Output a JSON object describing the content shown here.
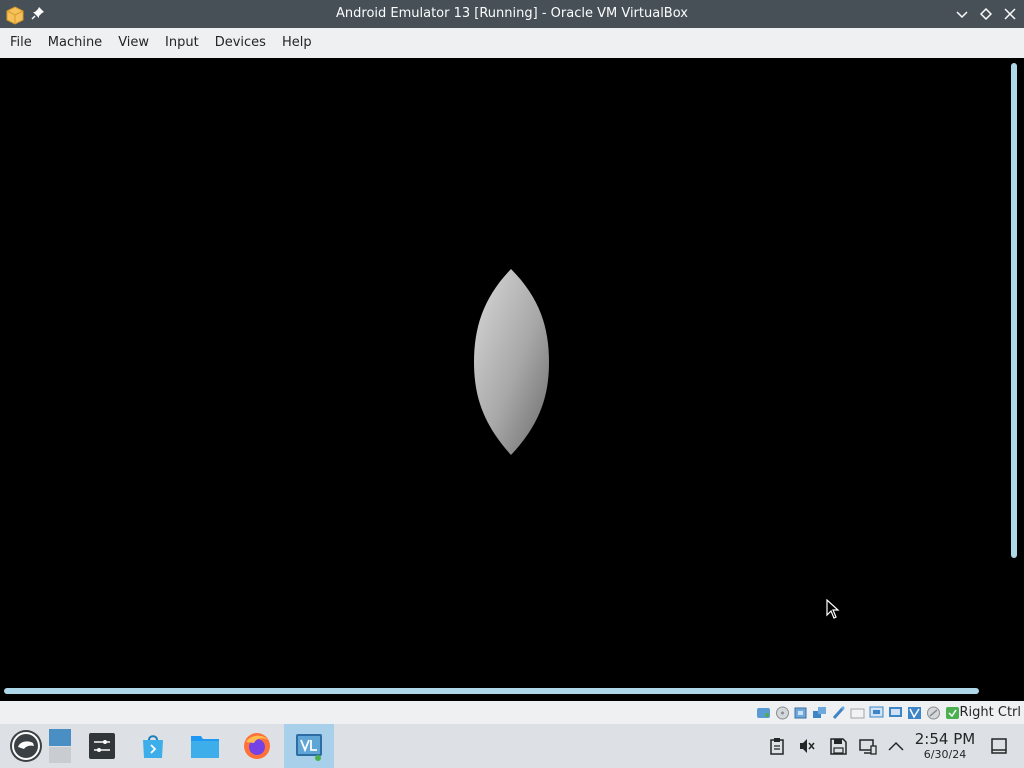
{
  "window": {
    "title": "Android Emulator 13 [Running] - Oracle VM VirtualBox"
  },
  "menubar": {
    "items": [
      "File",
      "Machine",
      "View",
      "Input",
      "Devices",
      "Help"
    ]
  },
  "statusbar": {
    "icons": [
      "hard-disk-icon",
      "optical-drive-icon",
      "audio-icon",
      "network-icon",
      "usb-icon",
      "shared-folders-icon",
      "display-icon",
      "video-capture-icon",
      "virtualization-icon",
      "mouse-integration-icon",
      "host-key-icon"
    ],
    "host_key": "Right Ctrl"
  },
  "taskbar": {
    "clock_time": "2:54 PM",
    "clock_date": "6/30/24"
  },
  "colors": {
    "titlebar": "#475057",
    "menubar": "#eff0f1",
    "scrollbar": "#aed7ea",
    "taskbar": "#dde1e5"
  }
}
